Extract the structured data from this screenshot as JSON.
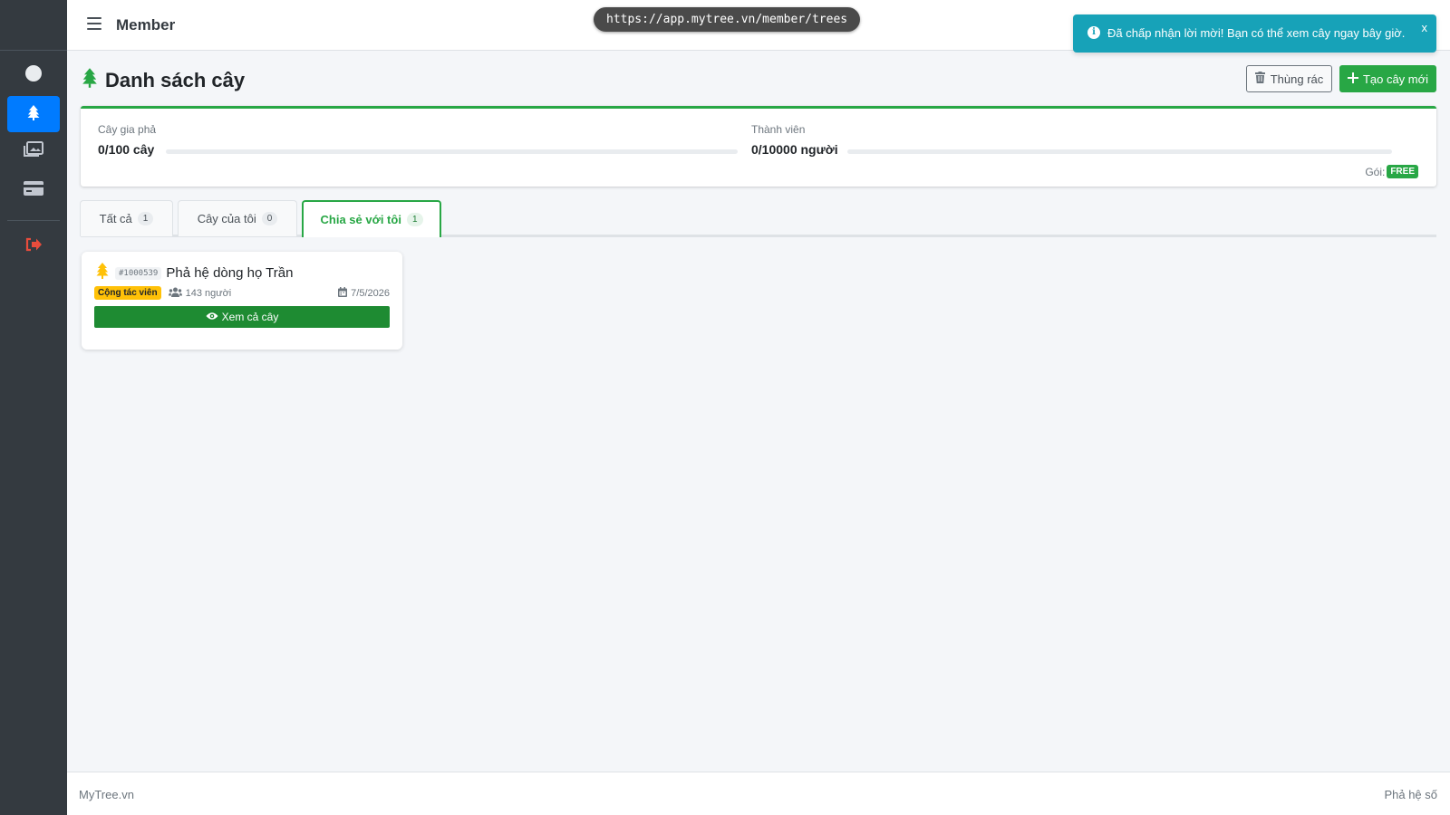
{
  "browser": {
    "url": "https://app.mytree.vn/member/trees"
  },
  "navbar": {
    "title": "Member"
  },
  "sidebar": {
    "items": [
      {
        "icon": "user-circle-icon",
        "active": false
      },
      {
        "icon": "tree-icon",
        "active": true
      },
      {
        "icon": "images-icon",
        "active": false
      },
      {
        "icon": "credit-card-icon",
        "active": false
      },
      {
        "icon": "logout-icon",
        "active": false
      }
    ]
  },
  "toast": {
    "message": "Đã chấp nhận lời mời! Bạn có thể xem cây ngay bây giờ.",
    "close": "x",
    "icon": "info-icon"
  },
  "page": {
    "title": "Danh sách cây",
    "trash_button": "Thùng rác",
    "create_button": "Tạo cây mới"
  },
  "stats": {
    "trees_label": "Cây gia phả",
    "trees_value": "0/100 cây",
    "trees_progress": 0,
    "members_label": "Thành viên",
    "members_value": "0/10000 người",
    "members_progress": 0,
    "plan_label": "Gói:",
    "plan_value": "FREE"
  },
  "tabs": [
    {
      "label": "Tất cả",
      "count": "1",
      "active": false
    },
    {
      "label": "Cây của tôi",
      "count": "0",
      "active": false
    },
    {
      "label": "Chia sẻ với tôi",
      "count": "1",
      "active": true
    }
  ],
  "trees": [
    {
      "id": "#1000539",
      "name": "Phả hệ dòng họ Trần",
      "role": "Cộng tác viên",
      "members": "143 người",
      "date": "7/5/2026",
      "view_button": "Xem cả cây"
    }
  ],
  "footer": {
    "left": "MyTree.vn",
    "right": "Phả hệ số"
  },
  "colors": {
    "sidebar": "#343a40",
    "primary": "#007bff",
    "success": "#28a745",
    "info": "#17a2b8",
    "warning": "#ffc107",
    "danger": "#e74c3c"
  }
}
